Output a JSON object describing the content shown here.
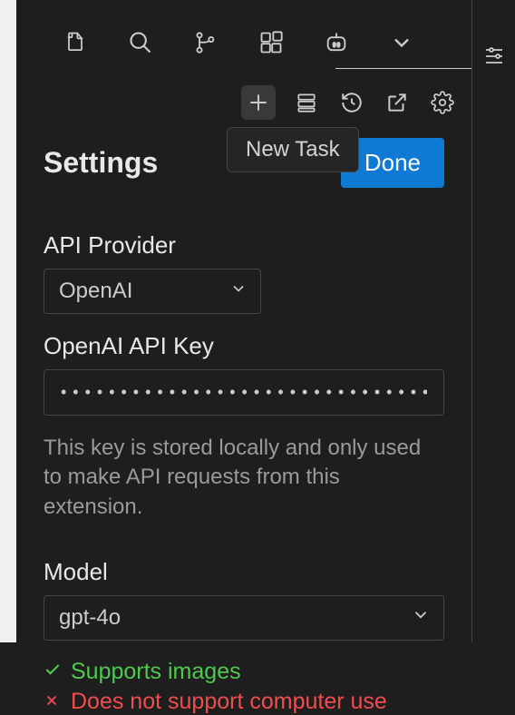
{
  "tooltip": "New Task",
  "page": {
    "title": "Settings",
    "done_label": "Done"
  },
  "fields": {
    "api_provider": {
      "label": "API Provider",
      "value": "OpenAI"
    },
    "api_key": {
      "label": "OpenAI API Key",
      "masked_value": "•••••••••••••••••••••••••••••••••",
      "help": "This key is stored locally and only used to make API requests from this extension."
    },
    "model": {
      "label": "Model",
      "value": "gpt-4o"
    }
  },
  "capabilities": {
    "supports_images": "Supports images",
    "no_computer_use": "Does not support computer use"
  }
}
